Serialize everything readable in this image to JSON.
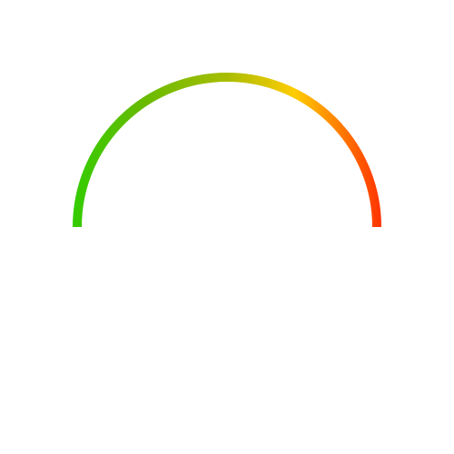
{
  "gauge": {
    "arc_colors": {
      "start": "#33cc00",
      "mid_left": "#66bb00",
      "top": "#a8bd00",
      "mid_right": "#ffcc00",
      "end": "#ff3300"
    },
    "fill_fraction": 1.0,
    "scale_min": "",
    "scale_max": "",
    "value_label": ""
  }
}
